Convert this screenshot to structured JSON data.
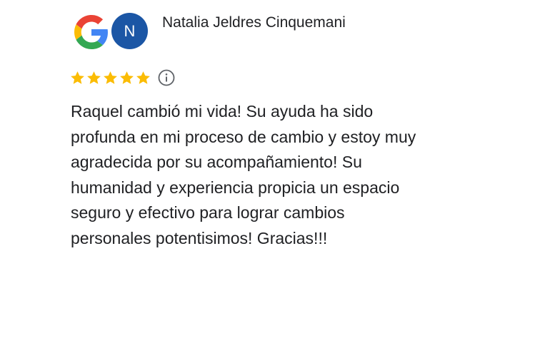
{
  "review": {
    "reviewer_name": "Natalia Jeldres Cinquemani",
    "avatar_initial": "N",
    "rating": 5,
    "rating_max": 5,
    "text_lines": [
      "Raquel cambió mi vida! Su ayuda ha sido",
      "profunda en mi proceso de cambio y estoy muy",
      "agradecida por su acompañamiento! Su",
      "humanidad y experiencia propicia un espacio",
      "seguro y efectivo para lograr cambios",
      "personales potentisimos! Gracias!!!"
    ]
  },
  "icons": {
    "source_logo": "google-g-icon",
    "star": "star-icon",
    "info": "info-icon"
  },
  "colors": {
    "avatar_bg": "#1b56a5",
    "star": "#fbbc04",
    "text": "#202124",
    "info_icon": "#5f6368",
    "google_blue": "#4285f4",
    "google_red": "#ea4335",
    "google_yellow": "#fbbc05",
    "google_green": "#34a853"
  }
}
